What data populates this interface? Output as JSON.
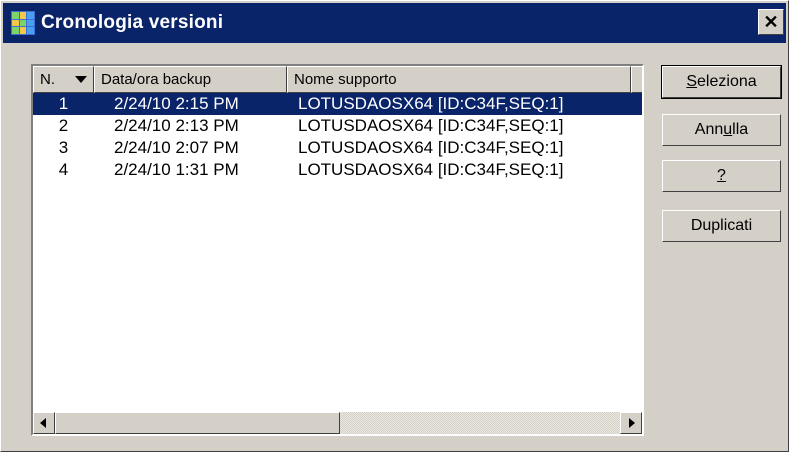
{
  "window": {
    "title": "Cronologia versioni",
    "close_glyph": "✕"
  },
  "list": {
    "columns": [
      "N.",
      "Data/ora backup",
      "Nome supporto",
      ""
    ],
    "sort_icon": "sort-descending-icon",
    "rows": [
      {
        "n": "1",
        "date": "2/24/10  2:15 PM",
        "media": "LOTUSDAOSX64 [ID:C34F,SEQ:1]",
        "selected": true
      },
      {
        "n": "2",
        "date": "2/24/10  2:13 PM",
        "media": "LOTUSDAOSX64 [ID:C34F,SEQ:1]",
        "selected": false
      },
      {
        "n": "3",
        "date": "2/24/10  2:07 PM",
        "media": "LOTUSDAOSX64 [ID:C34F,SEQ:1]",
        "selected": false
      },
      {
        "n": "4",
        "date": "2/24/10  1:31 PM",
        "media": "LOTUSDAOSX64 [ID:C34F,SEQ:1]",
        "selected": false
      }
    ]
  },
  "buttons": {
    "select": {
      "before": "",
      "mnemonic": "S",
      "after": "eleziona"
    },
    "cancel": {
      "before": "Ann",
      "mnemonic": "u",
      "after": "lla"
    },
    "help": {
      "before": "",
      "mnemonic": "?",
      "after": ""
    },
    "duplicates": "Duplicati"
  },
  "colors": {
    "titlebar": "#0a246a",
    "selection": "#0a246a",
    "face": "#d4d0c8"
  }
}
